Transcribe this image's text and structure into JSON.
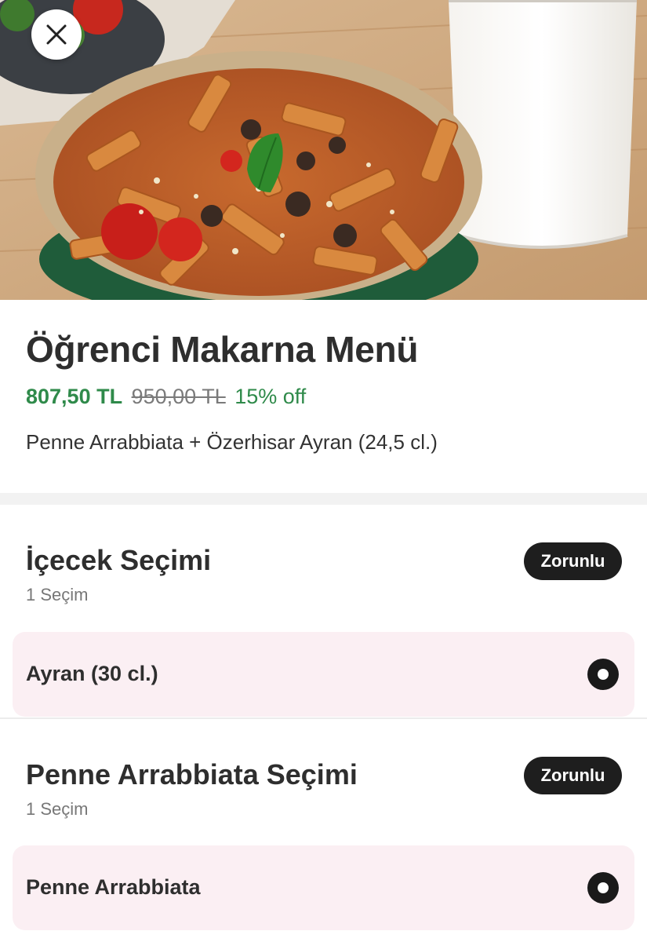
{
  "hero": {
    "image": "pasta-bowl-with-ayran-photo",
    "close_icon": "close-icon"
  },
  "product": {
    "title": "Öğrenci Makarna Menü",
    "price_now": "807,50 TL",
    "price_old": "950,00 TL",
    "discount": "15% off",
    "description": "Penne Arrabbiata + Özerhisar Ayran (24,5 cl.)"
  },
  "groups": [
    {
      "title": "İçecek Seçimi",
      "subtitle": "1 Seçim",
      "badge": "Zorunlu",
      "options": [
        {
          "label": "Ayran (30 cl.)",
          "selected": true
        }
      ]
    },
    {
      "title": "Penne Arrabbiata Seçimi",
      "subtitle": "1 Seçim",
      "badge": "Zorunlu",
      "options": [
        {
          "label": "Penne Arrabbiata",
          "selected": true
        }
      ]
    }
  ],
  "colors": {
    "price_green": "#2f8a4a",
    "badge_bg": "#1e1e1e",
    "option_bg": "#fbeff3"
  }
}
